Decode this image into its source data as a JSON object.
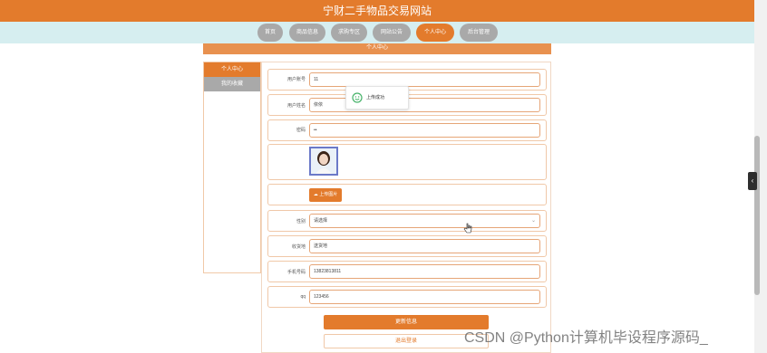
{
  "header": {
    "title": "宁财二手物品交易网站"
  },
  "nav": {
    "items": [
      {
        "label": "首页"
      },
      {
        "label": "商品信息"
      },
      {
        "label": "求购专区"
      },
      {
        "label": "网站公告"
      },
      {
        "label": "个人中心"
      },
      {
        "label": "后台管理"
      }
    ]
  },
  "page": {
    "band_title": "个人中心"
  },
  "sidebar": {
    "items": [
      {
        "label": "个人中心"
      },
      {
        "label": "我的收藏"
      }
    ]
  },
  "form": {
    "account_label": "用户账号",
    "account_value": "11",
    "name_label": "用户姓名",
    "name_value": "依依",
    "password_label": "密码",
    "password_value": "••",
    "upload_label": "上传图片",
    "gender_label": "性别",
    "gender_value": "请选择",
    "address_label": "收货地",
    "address_value": "送货地",
    "phone_label": "手机号码",
    "phone_value": "13823813811",
    "qq_label": "qq",
    "qq_value": "123456"
  },
  "toast": {
    "text": "上传成功"
  },
  "buttons": {
    "update": "更新信息",
    "logout": "退出登录"
  },
  "watermark": {
    "text": "CSDN @Python计算机毕设程序源码_"
  },
  "colors": {
    "accent": "#e37b2c",
    "nav_bg": "#d6eef0",
    "inactive": "#a9a9a9"
  }
}
